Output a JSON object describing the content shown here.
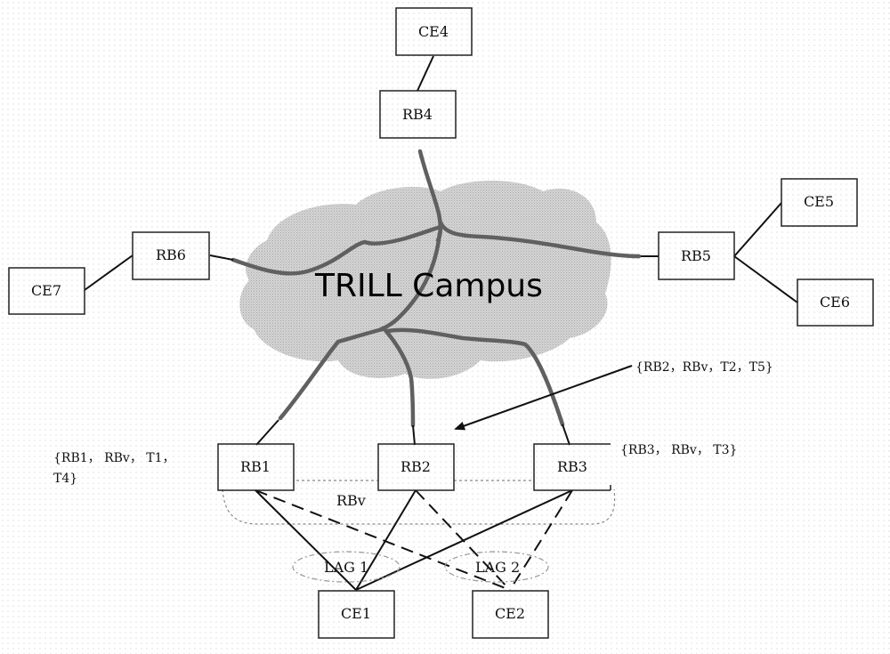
{
  "cloud": {
    "label": "TRILL Campus",
    "fill_color": "#cfcfcf",
    "link_color": "#606060"
  },
  "nodes": {
    "CE4": "CE4",
    "RB4": "RB4",
    "RB6": "RB6",
    "CE7": "CE7",
    "RB5": "RB5",
    "CE5": "CE5",
    "CE6": "CE6",
    "RB1": "RB1",
    "RB2": "RB2",
    "RB3": "RB3",
    "CE1": "CE1",
    "CE2": "CE2"
  },
  "virtual_rbridge": {
    "label": "RBv"
  },
  "lags": [
    {
      "label": "LAG  1"
    },
    {
      "label": "LAG  2"
    }
  ],
  "annotations": {
    "rb1_line1": "{RB1， RBv， T1，",
    "rb1_line2": "T4}",
    "rb2": "{RB2，RBv，T2，T5}",
    "rb3": "{RB3， RBv， T3}"
  }
}
